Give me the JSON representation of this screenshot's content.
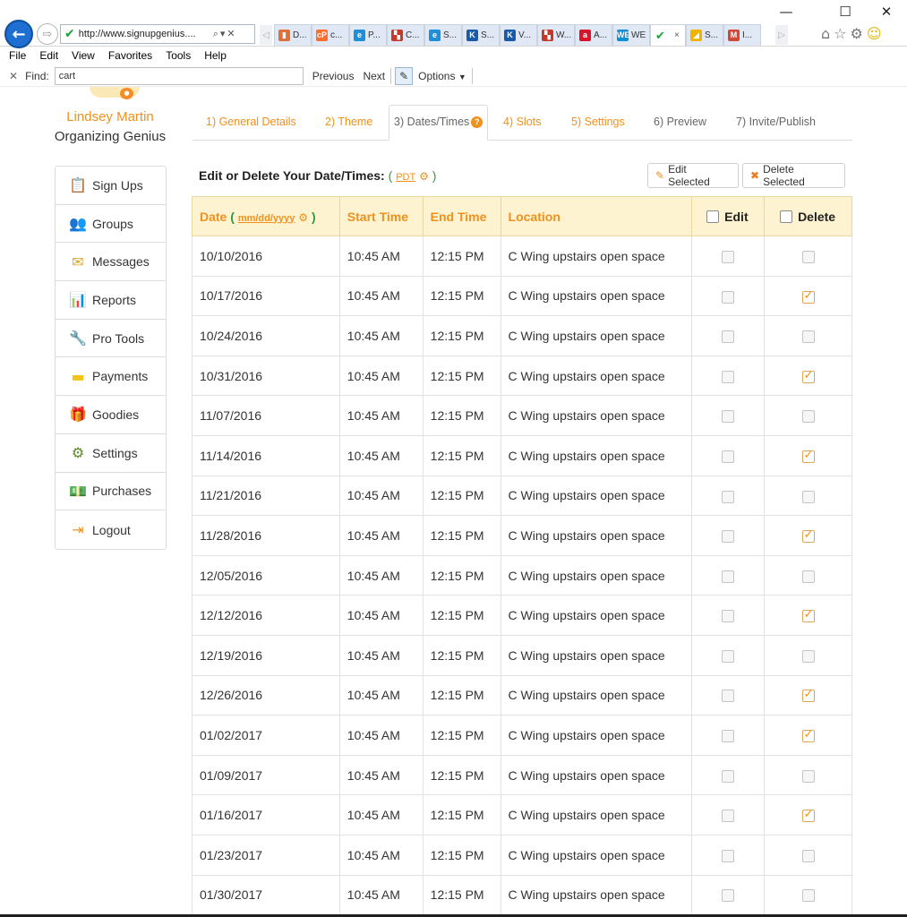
{
  "browser": {
    "url": "http://www.signupgenius....",
    "window_controls": [
      "—",
      "☐",
      "✕"
    ],
    "tabs": [
      {
        "label": "D...",
        "icon": "chart-favicon",
        "color": "#e0703a",
        "glyph": "▮"
      },
      {
        "label": "c...",
        "icon": "cpanel-favicon",
        "color": "#ff6c2c",
        "glyph": "cP"
      },
      {
        "label": "P...",
        "icon": "ie-favicon",
        "color": "#1f8fd8",
        "glyph": "e"
      },
      {
        "label": "C...",
        "icon": "colorful-favicon",
        "color": "#c53929",
        "glyph": "▚"
      },
      {
        "label": "S...",
        "icon": "ie-favicon",
        "color": "#1f8fd8",
        "glyph": "e"
      },
      {
        "label": "S...",
        "icon": "k-favicon",
        "color": "#1b5aa6",
        "glyph": "K"
      },
      {
        "label": "V...",
        "icon": "k-favicon",
        "color": "#1b5aa6",
        "glyph": "K"
      },
      {
        "label": "W...",
        "icon": "colorful-favicon",
        "color": "#c53929",
        "glyph": "▚"
      },
      {
        "label": "A...",
        "icon": "a-favicon",
        "color": "#d7142a",
        "glyph": "a"
      },
      {
        "label": "WE",
        "icon": "we-favicon",
        "color": "#0e8fd6",
        "glyph": "WE"
      },
      {
        "label": "",
        "icon": "signupgenius-favicon",
        "color": "#1aa23a",
        "glyph": "✔",
        "active": true
      },
      {
        "label": "S...",
        "icon": "sail-favicon",
        "color": "#f0b400",
        "glyph": "◢"
      },
      {
        "label": "I...",
        "icon": "gmail-favicon",
        "color": "#d14836",
        "glyph": "M"
      }
    ],
    "menu": [
      "File",
      "Edit",
      "View",
      "Favorites",
      "Tools",
      "Help"
    ],
    "find": {
      "label": "Find:",
      "value": "cart",
      "previous": "Previous",
      "next": "Next",
      "options": "Options"
    }
  },
  "user": {
    "name": "Lindsey Martin",
    "role": "Organizing Genius"
  },
  "sidebar": {
    "items": [
      {
        "label": "Sign Ups",
        "icon": "clipboard-icon",
        "glyph": "📋",
        "color": "#444"
      },
      {
        "label": "Groups",
        "icon": "people-icon",
        "glyph": "👥",
        "color": "#5a3d2b"
      },
      {
        "label": "Messages",
        "icon": "envelope-icon",
        "glyph": "✉",
        "color": "#d9a72c"
      },
      {
        "label": "Reports",
        "icon": "bar-chart-icon",
        "glyph": "📊",
        "color": "#e08a1e"
      },
      {
        "label": "Pro Tools",
        "icon": "wrench-icon",
        "glyph": "🔧",
        "color": "#333"
      },
      {
        "label": "Payments",
        "icon": "credit-card-icon",
        "glyph": "▬",
        "color": "#f0c419"
      },
      {
        "label": "Goodies",
        "icon": "gift-icon",
        "glyph": "🎁",
        "color": "#e08a1e"
      },
      {
        "label": "Settings",
        "icon": "gear-icon",
        "glyph": "⚙",
        "color": "#5a8a2a"
      },
      {
        "label": "Purchases",
        "icon": "money-icon",
        "glyph": "💵",
        "color": "#3c7a2a"
      },
      {
        "label": "Logout",
        "icon": "logout-icon",
        "glyph": "⇥",
        "color": "#f0901d"
      }
    ]
  },
  "wizard": {
    "steps": [
      "1) General Details",
      "2) Theme",
      "3) Dates/Times",
      "4) Slots",
      "5) Settings",
      "6) Preview",
      "7) Invite/Publish"
    ],
    "help_glyph": "?"
  },
  "editor": {
    "title": "Edit or Delete Your Date/Times:",
    "tz_open": "(",
    "timezone": "PDT",
    "tz_close": ")",
    "edit_selected": "Edit Selected",
    "delete_selected": "Delete Selected"
  },
  "table": {
    "headers": {
      "date": "Date",
      "date_format": "mm/dd/yyyy",
      "start": "Start Time",
      "end": "End Time",
      "location": "Location",
      "edit": "Edit",
      "delete": "Delete"
    },
    "rows": [
      {
        "date": "10/10/2016",
        "start": "10:45 AM",
        "end": "12:15 PM",
        "location": "C Wing upstairs open space",
        "edit": false,
        "delete": false
      },
      {
        "date": "10/17/2016",
        "start": "10:45 AM",
        "end": "12:15 PM",
        "location": "C Wing upstairs open space",
        "edit": false,
        "delete": true
      },
      {
        "date": "10/24/2016",
        "start": "10:45 AM",
        "end": "12:15 PM",
        "location": "C Wing upstairs open space",
        "edit": false,
        "delete": false
      },
      {
        "date": "10/31/2016",
        "start": "10:45 AM",
        "end": "12:15 PM",
        "location": "C Wing upstairs open space",
        "edit": false,
        "delete": true
      },
      {
        "date": "11/07/2016",
        "start": "10:45 AM",
        "end": "12:15 PM",
        "location": "C Wing upstairs open space",
        "edit": false,
        "delete": false
      },
      {
        "date": "11/14/2016",
        "start": "10:45 AM",
        "end": "12:15 PM",
        "location": "C Wing upstairs open space",
        "edit": false,
        "delete": true
      },
      {
        "date": "11/21/2016",
        "start": "10:45 AM",
        "end": "12:15 PM",
        "location": "C Wing upstairs open space",
        "edit": false,
        "delete": false
      },
      {
        "date": "11/28/2016",
        "start": "10:45 AM",
        "end": "12:15 PM",
        "location": "C Wing upstairs open space",
        "edit": false,
        "delete": true
      },
      {
        "date": "12/05/2016",
        "start": "10:45 AM",
        "end": "12:15 PM",
        "location": "C Wing upstairs open space",
        "edit": false,
        "delete": false
      },
      {
        "date": "12/12/2016",
        "start": "10:45 AM",
        "end": "12:15 PM",
        "location": "C Wing upstairs open space",
        "edit": false,
        "delete": true
      },
      {
        "date": "12/19/2016",
        "start": "10:45 AM",
        "end": "12:15 PM",
        "location": "C Wing upstairs open space",
        "edit": false,
        "delete": false
      },
      {
        "date": "12/26/2016",
        "start": "10:45 AM",
        "end": "12:15 PM",
        "location": "C Wing upstairs open space",
        "edit": false,
        "delete": true
      },
      {
        "date": "01/02/2017",
        "start": "10:45 AM",
        "end": "12:15 PM",
        "location": "C Wing upstairs open space",
        "edit": false,
        "delete": true
      },
      {
        "date": "01/09/2017",
        "start": "10:45 AM",
        "end": "12:15 PM",
        "location": "C Wing upstairs open space",
        "edit": false,
        "delete": false
      },
      {
        "date": "01/16/2017",
        "start": "10:45 AM",
        "end": "12:15 PM",
        "location": "C Wing upstairs open space",
        "edit": false,
        "delete": true
      },
      {
        "date": "01/23/2017",
        "start": "10:45 AM",
        "end": "12:15 PM",
        "location": "C Wing upstairs open space",
        "edit": false,
        "delete": false
      },
      {
        "date": "01/30/2017",
        "start": "10:45 AM",
        "end": "12:15 PM",
        "location": "C Wing upstairs open space",
        "edit": false,
        "delete": false
      }
    ]
  },
  "colors": {
    "accent": "#f0901d",
    "header_bg": "#fdf3d0",
    "tz_green": "#2f9b40"
  }
}
